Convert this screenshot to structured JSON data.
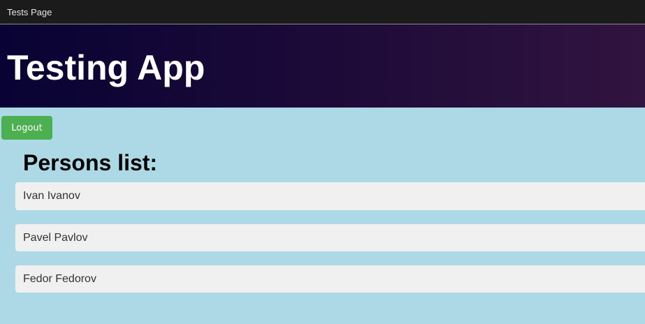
{
  "topbar": {
    "title": "Tests Page"
  },
  "banner": {
    "title": "Testing App"
  },
  "actions": {
    "logout_label": "Logout"
  },
  "persons": {
    "heading": "Persons list:",
    "items": [
      {
        "name": "Ivan Ivanov"
      },
      {
        "name": "Pavel Pavlov"
      },
      {
        "name": "Fedor Fedorov"
      }
    ]
  },
  "colors": {
    "topbar_bg": "#1b1b1b",
    "banner_start": "#080334",
    "banner_end": "#31143f",
    "page_bg": "#add8e6",
    "logout_bg": "#4caf50",
    "list_item_bg": "#f0f0f0"
  }
}
